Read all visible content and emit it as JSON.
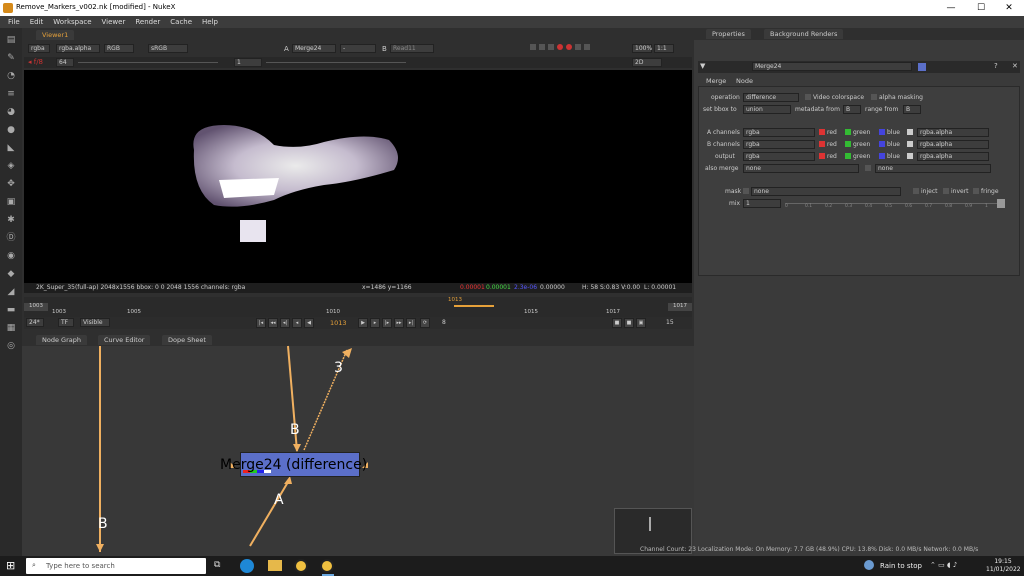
{
  "window": {
    "title": "Remove_Markers_v002.nk [modified] - NukeX",
    "minimize": "—",
    "maximize": "☐",
    "close": "✕"
  },
  "menu": [
    "File",
    "Edit",
    "Workspace",
    "Viewer",
    "Render",
    "Cache",
    "Help"
  ],
  "viewer": {
    "tab": "Viewer1",
    "toolbar": {
      "layer": "rgba",
      "channel": "rgba.alpha",
      "display": "RGB",
      "lut": "sRGB",
      "a_label": "A",
      "a_input": "Merge24",
      "b_label": "B",
      "b_input": "Read11",
      "zoom": "100%",
      "ratio": "1:1",
      "view_mode": "2D"
    },
    "toolbar2": {
      "frame_gain": "64",
      "y_value": "1"
    },
    "info": {
      "format": "2K_Super_35(full-ap) 2048x1556  bbox: 0 0 2048 1556 channels: rgba",
      "coords": "x=1486 y=1166",
      "r": "0.00001",
      "g": "0.00001",
      "b": "2.3e-06",
      "a": "0.00000",
      "hsv": "H: 58 S:0.83 V:0.00",
      "lum": "L: 0.00001"
    }
  },
  "timeline": {
    "start": "1003",
    "end": "1017",
    "current": "1013",
    "ticks": [
      "1003",
      "1005",
      "1010",
      "1015",
      "1017"
    ],
    "fps": "24*",
    "tf": "TF",
    "visible": "Visible",
    "frame": "1013",
    "step": "8",
    "inc": "15"
  },
  "panels": {
    "tabs": [
      "Node Graph",
      "Curve Editor",
      "Dope Sheet"
    ]
  },
  "nodegraph": {
    "node_label": "Merge24 (difference)",
    "input_a": "A",
    "input_b": "B",
    "input_3": "3",
    "input_b2": "B",
    "node_color": "#5b6fc9"
  },
  "properties": {
    "tabs": [
      "Properties",
      "Background Renders"
    ],
    "node_name": "Merge24",
    "subtabs": [
      "Merge",
      "Node"
    ],
    "operation_label": "operation",
    "operation_value": "difference",
    "video_colorspace": "Video colorspace",
    "alpha_masking": "alpha masking",
    "bbox_label": "set bbox to",
    "bbox_value": "union",
    "metadata_label": "metadata from",
    "metadata_value": "B",
    "range_label": "range from",
    "range_value": "B",
    "a_channels_label": "A channels",
    "a_channels_value": "rgba",
    "b_channels_label": "B channels",
    "b_channels_value": "rgba",
    "output_label": "output",
    "output_value": "rgba",
    "red": "red",
    "green": "green",
    "blue": "blue",
    "alpha": "rgba.alpha",
    "also_merge_label": "also merge",
    "also_merge_value": "none",
    "also_merge_value2": "none",
    "mask_label": "mask",
    "mask_value": "none",
    "inject": "inject",
    "invert": "invert",
    "fringe": "fringe",
    "mix_label": "mix",
    "mix_value": "1",
    "mix_ticks": [
      "0",
      "0.1",
      "0.2",
      "0.3",
      "0.4",
      "0.5",
      "0.6",
      "0.7",
      "0.8",
      "0.9",
      "1"
    ]
  },
  "statusbar": "Channel Count: 23  Localization Mode: On  Memory: 7.7 GB (48.9%)  CPU: 13.8%  Disk: 0.0 MB/s  Network: 0.0 MB/s",
  "taskbar": {
    "search_placeholder": "Type here to search",
    "weather": "Rain to stop",
    "time": "19:15",
    "date": "11/01/2022"
  }
}
